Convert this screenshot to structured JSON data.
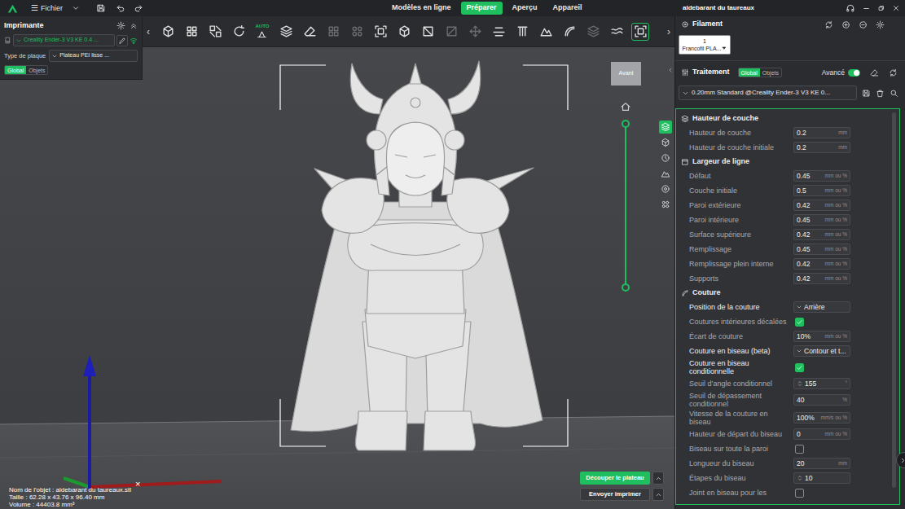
{
  "titlebar": {
    "menu_icon": "☰",
    "file_menu": "Fichier",
    "tabs": [
      {
        "label": "Modèles en ligne",
        "selected": false
      },
      {
        "label": "Préparer",
        "selected": true
      },
      {
        "label": "Aperçu",
        "selected": false
      },
      {
        "label": "Appareil",
        "selected": false
      }
    ],
    "project_title": "aldebarant du taureaux"
  },
  "printer_panel": {
    "title": "Imprimante",
    "printer": "Creality Ender-3 V3 KE 0.4 ...",
    "plate_label": "Type de plaque",
    "plate": "Plateau PEI lisse ...",
    "scope_tabs": [
      {
        "label": "Global",
        "selected": true
      },
      {
        "label": "Objets",
        "selected": false
      }
    ]
  },
  "toolbar": {
    "scroll_left": "‹",
    "scroll_right": "›",
    "buttons": [
      {
        "disabled": false,
        "selected": false
      },
      {
        "disabled": false,
        "selected": false
      },
      {
        "disabled": false,
        "selected": false
      },
      {
        "disabled": false,
        "selected": false
      },
      {
        "label": "AUTO",
        "disabled": false,
        "selected": false
      },
      {
        "disabled": false,
        "selected": false
      },
      {
        "disabled": false,
        "selected": false
      },
      {
        "disabled": true,
        "selected": false
      },
      {
        "disabled": true,
        "selected": false
      },
      {
        "disabled": false,
        "selected": false
      },
      {
        "disabled": false,
        "selected": false
      },
      {
        "disabled": false,
        "selected": false
      },
      {
        "disabled": true,
        "selected": false
      },
      {
        "disabled": true,
        "selected": false
      },
      {
        "disabled": false,
        "selected": false
      },
      {
        "disabled": false,
        "selected": false
      },
      {
        "disabled": false,
        "selected": false
      },
      {
        "disabled": false,
        "selected": false
      },
      {
        "disabled": true,
        "selected": false
      },
      {
        "disabled": false,
        "selected": false
      },
      {
        "disabled": false,
        "selected": true
      }
    ]
  },
  "viewport": {
    "view_cube": "Avant",
    "layer_slider": {
      "level": 1
    },
    "side_tools": [
      {
        "selected": true
      },
      {
        "selected": false
      },
      {
        "selected": false
      },
      {
        "selected": false
      },
      {
        "selected": false
      },
      {
        "selected": false
      }
    ]
  },
  "object_info": {
    "name": "Nom de l'objet : aldebarant du taureaux.stl",
    "size": "Taille : 62.28 x 43.76 x 96.40 mm",
    "volume": "Volume : 44403.8 mm³",
    "close": "×"
  },
  "actions": [
    {
      "label": "Découper le plateau",
      "primary": true
    },
    {
      "label": "Envoyer imprimer",
      "primary": false
    }
  ],
  "filament": {
    "title": "Filament",
    "slots": [
      {
        "number": "1",
        "name": "Francofil PLA...",
        "color": "#ffffff"
      }
    ]
  },
  "process": {
    "title": "Traitement",
    "scope_tabs": [
      {
        "label": "Global",
        "selected": true
      },
      {
        "label": "Objets",
        "selected": false
      }
    ],
    "advanced_label": "Avancé",
    "advanced_on": true,
    "profile": "0.20mm Standard @Creality Ender-3 V3 KE 0..."
  },
  "settings": {
    "sections": [
      {
        "title": "Hauteur de couche",
        "rows": [
          {
            "kind": "number",
            "label": "Hauteur de couche",
            "value": "0.2",
            "unit": "mm",
            "highlighted": false
          },
          {
            "kind": "number",
            "label": "Hauteur de couche initiale",
            "value": "0.2",
            "unit": "mm",
            "highlighted": false
          }
        ]
      },
      {
        "title": "Largeur de ligne",
        "rows": [
          {
            "kind": "number",
            "label": "Défaut",
            "value": "0.45",
            "unit": "mm ou %",
            "highlighted": false
          },
          {
            "kind": "number",
            "label": "Couche initiale",
            "value": "0.5",
            "unit": "mm ou %",
            "highlighted": false
          },
          {
            "kind": "number",
            "label": "Paroi extérieure",
            "value": "0.42",
            "unit": "mm ou %",
            "highlighted": false
          },
          {
            "kind": "number",
            "label": "Paroi intérieure",
            "value": "0.45",
            "unit": "mm ou %",
            "highlighted": false
          },
          {
            "kind": "number",
            "label": "Surface supérieure",
            "value": "0.42",
            "unit": "mm ou %",
            "highlighted": false
          },
          {
            "kind": "number",
            "label": "Remplissage",
            "value": "0.45",
            "unit": "mm ou %",
            "highlighted": false
          },
          {
            "kind": "number",
            "label": "Remplissage plein interne",
            "value": "0.42",
            "unit": "mm ou %",
            "highlighted": false
          },
          {
            "kind": "number",
            "label": "Supports",
            "value": "0.42",
            "unit": "mm ou %",
            "highlighted": false
          }
        ]
      },
      {
        "title": "Couture",
        "rows": [
          {
            "kind": "select",
            "label": "Position de la couture",
            "value": "Arrière",
            "highlighted": true
          },
          {
            "kind": "checkbox",
            "label": "Coutures intérieures décalées",
            "checked": true,
            "highlighted": false
          },
          {
            "kind": "number",
            "label": "Écart de couture",
            "value": "10%",
            "unit": "mm ou %",
            "highlighted": false
          },
          {
            "kind": "select",
            "label": "Couture en biseau (beta)",
            "value": "Contour et t...",
            "highlighted": true
          },
          {
            "kind": "checkbox",
            "label": "Couture en biseau conditionnelle",
            "checked": true,
            "highlighted": true
          },
          {
            "kind": "spin",
            "label": "Seuil d’angle conditionnel",
            "value": "155",
            "unit": "°",
            "highlighted": false
          },
          {
            "kind": "number",
            "label": "Seuil de dépassement conditionnel",
            "value": "40",
            "unit": "%",
            "highlighted": false
          },
          {
            "kind": "number",
            "label": "Vitesse de la couture en biseau",
            "value": "100%",
            "unit": "mm/s ou %",
            "highlighted": false
          },
          {
            "kind": "number",
            "label": "Hauteur de départ du biseau",
            "value": "0",
            "unit": "mm ou %",
            "highlighted": false
          },
          {
            "kind": "checkbox",
            "label": "Biseau sur toute la paroi",
            "checked": false,
            "highlighted": false
          },
          {
            "kind": "number",
            "label": "Longueur du biseau",
            "value": "20",
            "unit": "mm",
            "highlighted": false
          },
          {
            "kind": "spin",
            "label": "Étapes du biseau",
            "value": "10",
            "highlighted": false
          },
          {
            "kind": "checkbox",
            "label": "Joint en biseau pour les",
            "checked": false,
            "highlighted": false
          }
        ]
      }
    ]
  }
}
